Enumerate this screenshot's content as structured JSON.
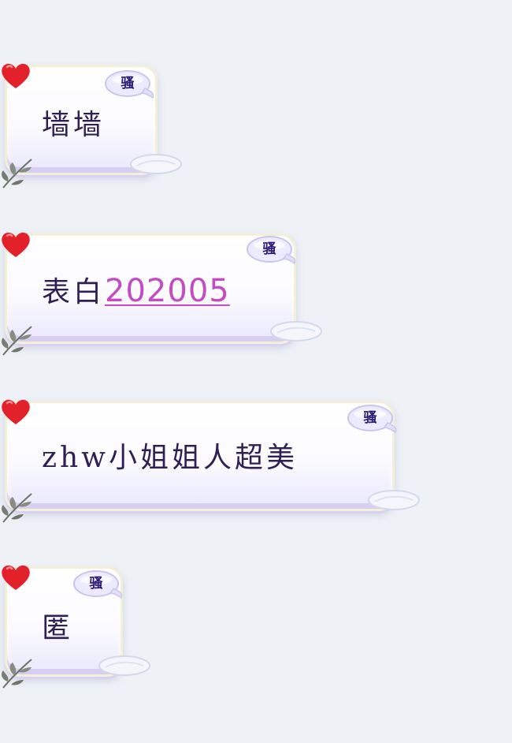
{
  "messages": [
    {
      "text": "墙墙",
      "link": "",
      "badge": "骚"
    },
    {
      "text": "表白",
      "link": "202005",
      "badge": "骚"
    },
    {
      "text": "zhw小姐姐人超美",
      "link": "",
      "badge": "骚"
    },
    {
      "text": "匿",
      "link": "",
      "badge": "骚"
    }
  ],
  "colors": {
    "text": "#2e1f55",
    "link": "#c24cc4",
    "badge_text": "#2b1b78",
    "heart": "#e3212b",
    "background": "#eef2f6"
  },
  "icons": [
    "heart-icon",
    "leaf-icon",
    "shell-icon"
  ]
}
